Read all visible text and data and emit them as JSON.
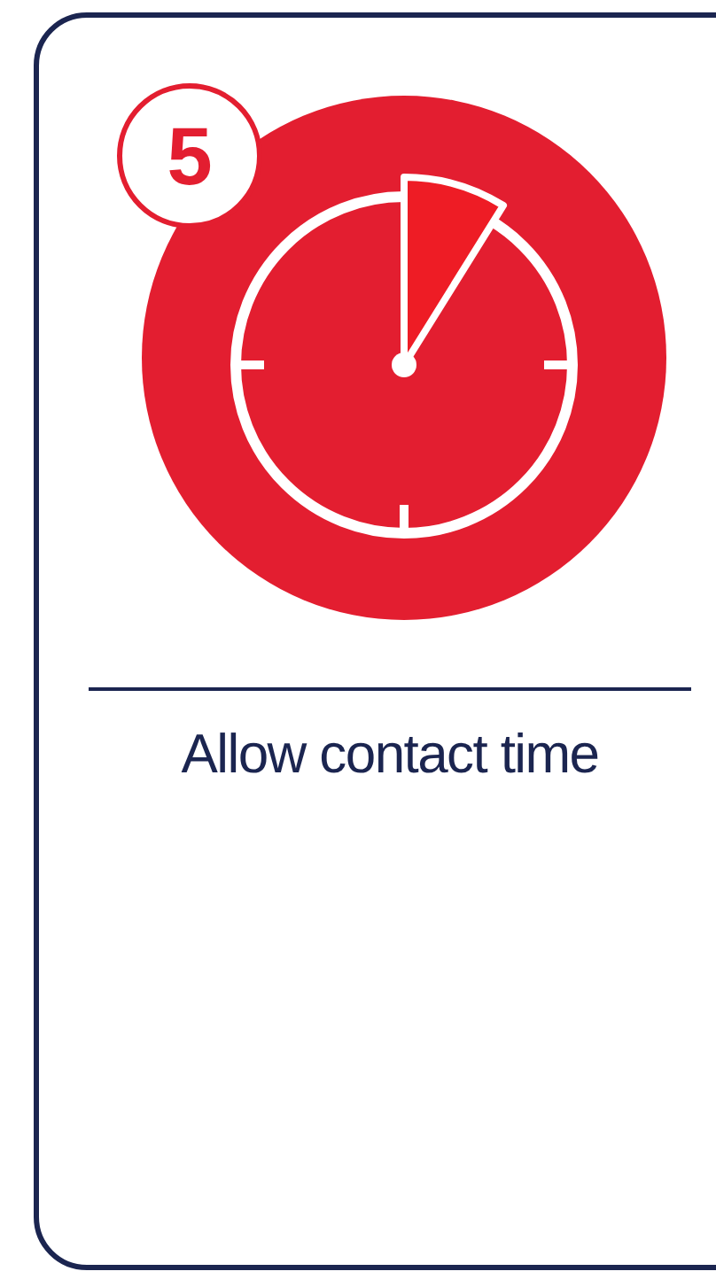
{
  "step": {
    "number": "5",
    "label": "Allow contact time"
  }
}
